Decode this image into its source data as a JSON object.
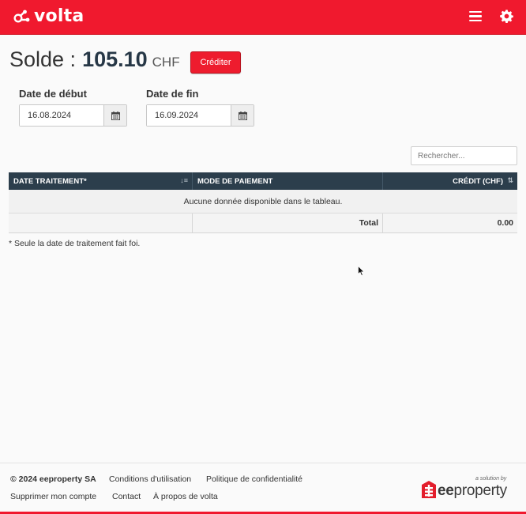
{
  "header": {
    "brand": "volta",
    "brand_color": "#f0192e",
    "menu_icon": "hamburger-icon",
    "settings_icon": "gear-icon"
  },
  "balance": {
    "label": "Solde :",
    "amount": "105.10",
    "currency": "CHF",
    "credit_button": "Créditer"
  },
  "filters": {
    "start_label": "Date de début",
    "start_value": "16.08.2024",
    "end_label": "Date de fin",
    "end_value": "16.09.2024",
    "calendar_icon": "calendar-icon"
  },
  "search": {
    "placeholder": "Rechercher...",
    "value": ""
  },
  "table": {
    "columns": [
      "DATE TRAITEMENT*",
      "MODE DE PAIEMENT",
      "CRÉDIT (CHF)"
    ],
    "empty_message": "Aucune donnée disponible dans le tableau.",
    "total_label": "Total",
    "total_value": "0.00"
  },
  "note": "* Seule la date de traitement fait foi.",
  "footer": {
    "copyright": "© 2024 eeproperty SA",
    "links": [
      "Conditions d'utilisation",
      "Politique de confidentialité",
      "Supprimer mon compte",
      "Contact",
      "À propos de volta"
    ],
    "partner_tag": "a solution by",
    "partner_name_bold": "ee",
    "partner_name_rest": "property"
  }
}
